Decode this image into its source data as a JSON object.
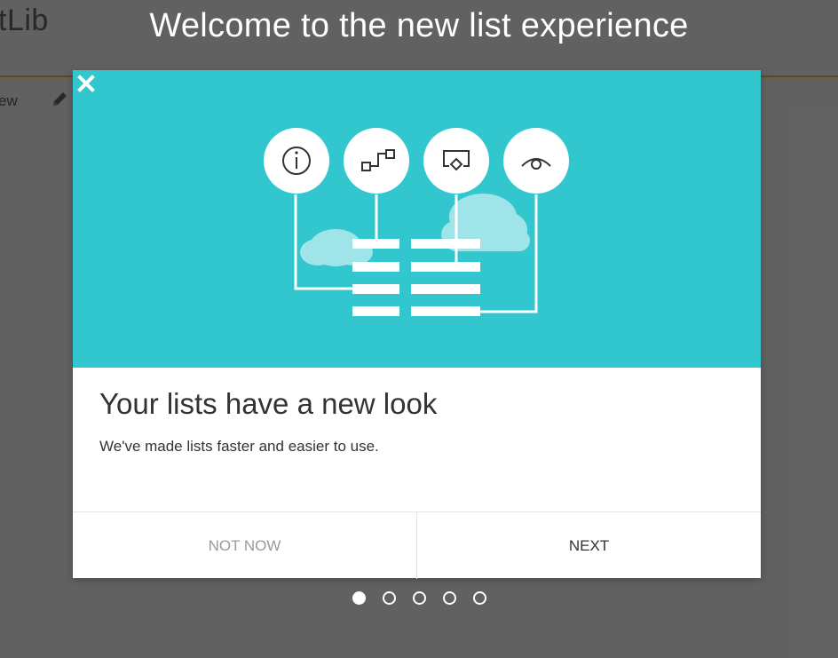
{
  "background": {
    "title_fragment": "tLib",
    "command_fragment": "ew"
  },
  "dialog": {
    "welcome_title": "Welcome to the new list experience",
    "heading": "Your lists have a new look",
    "body": "We've made lists faster and easier to use.",
    "secondary_button": "NOT NOW",
    "primary_button": "NEXT",
    "close_icon": "close-icon"
  },
  "hero": {
    "background_color": "#32c7cf",
    "icons": [
      "info-icon",
      "flow-icon",
      "tap-icon",
      "view-icon"
    ]
  },
  "pager": {
    "total": 5,
    "current": 1
  },
  "colors": {
    "accent": "#32c7cf",
    "overlay_bg": "#8c8c8c"
  }
}
